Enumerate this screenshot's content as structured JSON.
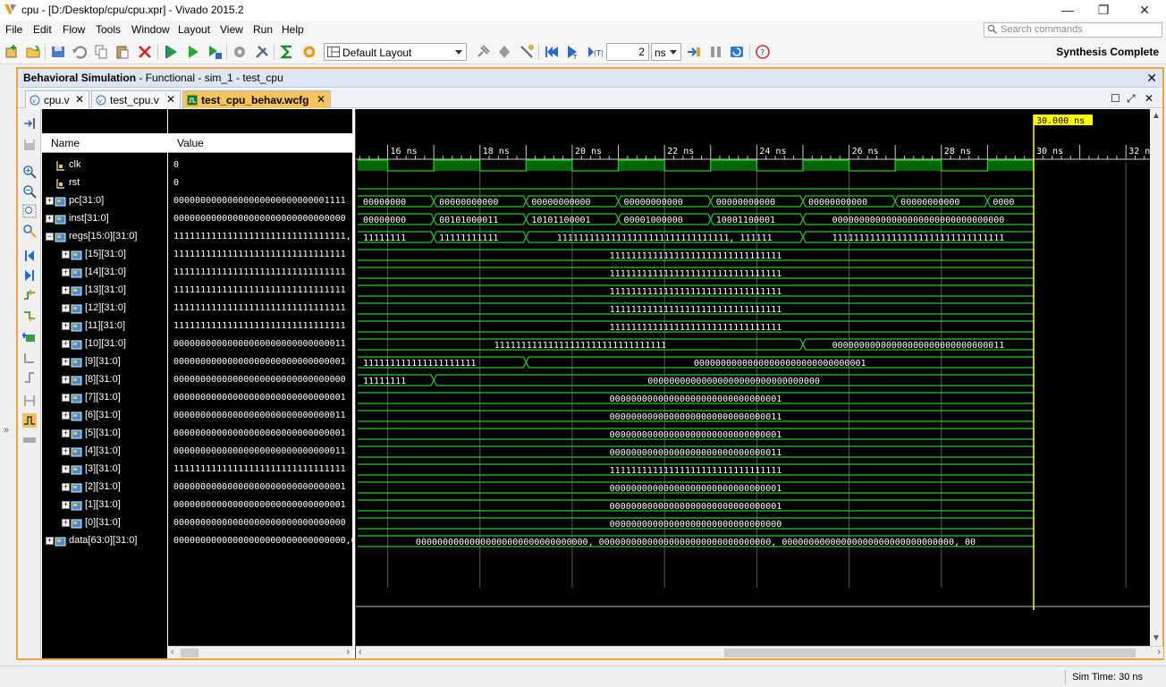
{
  "window": {
    "title": "cpu - [D:/Desktop/cpu/cpu.xpr] - Vivado 2015.2",
    "controls": [
      "—",
      "❐",
      "✕"
    ]
  },
  "menu": [
    "File",
    "Edit",
    "Flow",
    "Tools",
    "Window",
    "Layout",
    "View",
    "Run",
    "Help"
  ],
  "search": {
    "placeholder": "Search commands"
  },
  "toolbar": {
    "layout_select": "Default Layout",
    "run_time": "2",
    "run_unit": "ns",
    "status": "Synthesis Complete"
  },
  "panel": {
    "title_bold": "Behavioral Simulation",
    "title_rest": " - Functional - sim_1 - test_cpu",
    "close": "✕"
  },
  "tabs": [
    {
      "label": "cpu.v",
      "active": false
    },
    {
      "label": "test_cpu.v",
      "active": false
    },
    {
      "label": "test_cpu_behav.wcfg",
      "active": true
    }
  ],
  "columns": {
    "name": "Name",
    "value": "Value"
  },
  "signals": [
    {
      "name": "clk",
      "value": "0",
      "expander": "",
      "indent": 0
    },
    {
      "name": "rst",
      "value": "0",
      "expander": "",
      "indent": 0
    },
    {
      "name": "pc[31:0]",
      "value": "00000000000000000000000000001111",
      "expander": "+",
      "indent": 0
    },
    {
      "name": "inst[31:0]",
      "value": "00000000000000000000000000000000",
      "expander": "+",
      "indent": 0
    },
    {
      "name": "regs[15:0][31:0]",
      "value": "11111111111111111111111111111111,1",
      "expander": "−",
      "indent": 0
    },
    {
      "name": "[15][31:0]",
      "value": "11111111111111111111111111111111",
      "expander": "+",
      "indent": 1
    },
    {
      "name": "[14][31:0]",
      "value": "11111111111111111111111111111111",
      "expander": "+",
      "indent": 1
    },
    {
      "name": "[13][31:0]",
      "value": "11111111111111111111111111111111",
      "expander": "+",
      "indent": 1
    },
    {
      "name": "[12][31:0]",
      "value": "11111111111111111111111111111111",
      "expander": "+",
      "indent": 1
    },
    {
      "name": "[11][31:0]",
      "value": "11111111111111111111111111111111",
      "expander": "+",
      "indent": 1
    },
    {
      "name": "[10][31:0]",
      "value": "00000000000000000000000000000011",
      "expander": "+",
      "indent": 1
    },
    {
      "name": "[9][31:0]",
      "value": "00000000000000000000000000000001",
      "expander": "+",
      "indent": 1
    },
    {
      "name": "[8][31:0]",
      "value": "00000000000000000000000000000000",
      "expander": "+",
      "indent": 1
    },
    {
      "name": "[7][31:0]",
      "value": "00000000000000000000000000000001",
      "expander": "+",
      "indent": 1
    },
    {
      "name": "[6][31:0]",
      "value": "00000000000000000000000000000011",
      "expander": "+",
      "indent": 1
    },
    {
      "name": "[5][31:0]",
      "value": "00000000000000000000000000000001",
      "expander": "+",
      "indent": 1
    },
    {
      "name": "[4][31:0]",
      "value": "00000000000000000000000000000011",
      "expander": "+",
      "indent": 1
    },
    {
      "name": "[3][31:0]",
      "value": "11111111111111111111111111111111",
      "expander": "+",
      "indent": 1
    },
    {
      "name": "[2][31:0]",
      "value": "00000000000000000000000000000001",
      "expander": "+",
      "indent": 1
    },
    {
      "name": "[1][31:0]",
      "value": "00000000000000000000000000000001",
      "expander": "+",
      "indent": 1
    },
    {
      "name": "[0][31:0]",
      "value": "00000000000000000000000000000000",
      "expander": "+",
      "indent": 1
    },
    {
      "name": "data[63:0][31:0]",
      "value": "00000000000000000000000000000000,0",
      "expander": "+",
      "indent": 0
    }
  ],
  "waveform": {
    "time_range_ns": [
      15.35,
      32.5
    ],
    "cursor_ns": 30,
    "cursor_label": "30.000 ns",
    "tick_labels_ns": [
      16,
      18,
      20,
      22,
      24,
      26,
      28,
      30,
      32
    ],
    "tick_unit": "ns",
    "clk_period_ns": 2,
    "clk_first_rise_ns": 15,
    "sim_end_ns": 30,
    "bus_segments": [
      [],
      [],
      [
        {
          "start": 15.35,
          "end": 17,
          "label": "00000000"
        },
        {
          "start": 17,
          "end": 19,
          "label": "00000000000"
        },
        {
          "start": 19,
          "end": 21,
          "label": "00000000000"
        },
        {
          "start": 21,
          "end": 23,
          "label": "00000000000"
        },
        {
          "start": 23,
          "end": 25,
          "label": "00000000000"
        },
        {
          "start": 25,
          "end": 27,
          "label": "00000000000"
        },
        {
          "start": 27,
          "end": 29,
          "label": "00000000000"
        },
        {
          "start": 29,
          "end": 30,
          "label": "0000"
        }
      ],
      [
        {
          "start": 15.35,
          "end": 17,
          "label": "00000000"
        },
        {
          "start": 17,
          "end": 19,
          "label": "00101000011"
        },
        {
          "start": 19,
          "end": 21,
          "label": "10101100001"
        },
        {
          "start": 21,
          "end": 23,
          "label": "00001000000"
        },
        {
          "start": 23,
          "end": 25,
          "label": "10001100001"
        },
        {
          "start": 25,
          "end": 30,
          "label": "00000000000000000000000000000000"
        }
      ],
      [
        {
          "start": 15.35,
          "end": 17,
          "label": "11111111"
        },
        {
          "start": 17,
          "end": 19,
          "label": "11111111111"
        },
        {
          "start": 19,
          "end": 25,
          "label": "11111111111111111111111111111111, 111111"
        },
        {
          "start": 25,
          "end": 30,
          "label": "11111111111111111111111111111111"
        }
      ],
      [
        {
          "start": 15.35,
          "end": 30,
          "label": "11111111111111111111111111111111"
        }
      ],
      [
        {
          "start": 15.35,
          "end": 30,
          "label": "11111111111111111111111111111111"
        }
      ],
      [
        {
          "start": 15.35,
          "end": 30,
          "label": "11111111111111111111111111111111"
        }
      ],
      [
        {
          "start": 15.35,
          "end": 30,
          "label": "11111111111111111111111111111111"
        }
      ],
      [
        {
          "start": 15.35,
          "end": 30,
          "label": "11111111111111111111111111111111"
        }
      ],
      [
        {
          "start": 15.35,
          "end": 25,
          "label": "11111111111111111111111111111111"
        },
        {
          "start": 25,
          "end": 30,
          "label": "00000000000000000000000000000011"
        }
      ],
      [
        {
          "start": 15.35,
          "end": 19,
          "label": "111111111111111111111"
        },
        {
          "start": 19,
          "end": 30,
          "label": "00000000000000000000000000000001"
        }
      ],
      [
        {
          "start": 15.35,
          "end": 17,
          "label": "11111111"
        },
        {
          "start": 17,
          "end": 30,
          "label": "00000000000000000000000000000000"
        }
      ],
      [
        {
          "start": 15.35,
          "end": 30,
          "label": "00000000000000000000000000000001"
        }
      ],
      [
        {
          "start": 15.35,
          "end": 30,
          "label": "00000000000000000000000000000011"
        }
      ],
      [
        {
          "start": 15.35,
          "end": 30,
          "label": "00000000000000000000000000000001"
        }
      ],
      [
        {
          "start": 15.35,
          "end": 30,
          "label": "00000000000000000000000000000011"
        }
      ],
      [
        {
          "start": 15.35,
          "end": 30,
          "label": "11111111111111111111111111111111"
        }
      ],
      [
        {
          "start": 15.35,
          "end": 30,
          "label": "00000000000000000000000000000001"
        }
      ],
      [
        {
          "start": 15.35,
          "end": 30,
          "label": "00000000000000000000000000000001"
        }
      ],
      [
        {
          "start": 15.35,
          "end": 30,
          "label": "00000000000000000000000000000000"
        }
      ],
      [
        {
          "start": 15.35,
          "end": 30,
          "label": "00000000000000000000000000000000, 00000000000000000000000000000000, 00000000000000000000000000000000, 00"
        }
      ]
    ]
  },
  "colors": {
    "wave_green": "#22cc22",
    "clk_fill": "#006400",
    "cursor": "#ffff00",
    "panel_border": "#f2a23c"
  },
  "statusbar": {
    "sim_time": "Sim Time: 30 ns"
  }
}
